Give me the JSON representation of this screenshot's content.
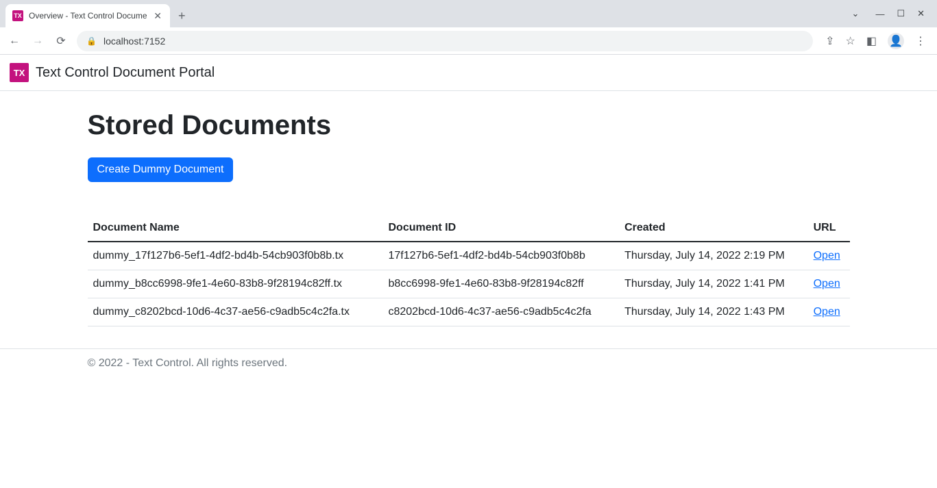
{
  "browser": {
    "tab_title": "Overview - Text Control Docume",
    "url": "localhost:7152"
  },
  "app": {
    "brand": "TX",
    "title": "Text Control Document Portal"
  },
  "page": {
    "heading": "Stored Documents",
    "create_button": "Create Dummy Document"
  },
  "table": {
    "headers": {
      "name": "Document Name",
      "id": "Document ID",
      "created": "Created",
      "url": "URL"
    },
    "rows": [
      {
        "name": "dummy_17f127b6-5ef1-4df2-bd4b-54cb903f0b8b.tx",
        "id": "17f127b6-5ef1-4df2-bd4b-54cb903f0b8b",
        "created": "Thursday, July 14, 2022 2:19 PM",
        "link": "Open"
      },
      {
        "name": "dummy_b8cc6998-9fe1-4e60-83b8-9f28194c82ff.tx",
        "id": "b8cc6998-9fe1-4e60-83b8-9f28194c82ff",
        "created": "Thursday, July 14, 2022 1:41 PM",
        "link": "Open"
      },
      {
        "name": "dummy_c8202bcd-10d6-4c37-ae56-c9adb5c4c2fa.tx",
        "id": "c8202bcd-10d6-4c37-ae56-c9adb5c4c2fa",
        "created": "Thursday, July 14, 2022 1:43 PM",
        "link": "Open"
      }
    ]
  },
  "footer": {
    "text": "© 2022 - Text Control. All rights reserved."
  }
}
